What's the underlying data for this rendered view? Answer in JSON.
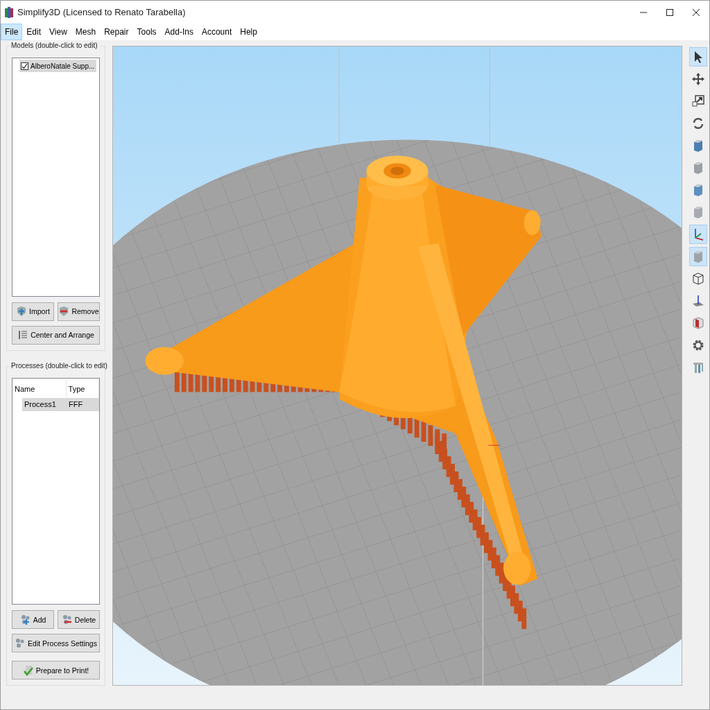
{
  "window": {
    "title": "Simplify3D (Licensed to Renato Tarabella)"
  },
  "menu": [
    {
      "label": "File",
      "selected": true
    },
    {
      "label": "Edit",
      "selected": false
    },
    {
      "label": "View",
      "selected": false
    },
    {
      "label": "Mesh",
      "selected": false
    },
    {
      "label": "Repair",
      "selected": false
    },
    {
      "label": "Tools",
      "selected": false
    },
    {
      "label": "Add-Ins",
      "selected": false
    },
    {
      "label": "Account",
      "selected": false
    },
    {
      "label": "Help",
      "selected": false
    }
  ],
  "models": {
    "title": "Models (double-click to edit)",
    "items": [
      {
        "label": "AlberoNatale Supp...",
        "checked": true,
        "selected": true
      }
    ],
    "buttons": [
      {
        "kind": "import",
        "label": "Import"
      },
      {
        "kind": "remove",
        "label": "Remove"
      },
      {
        "kind": "arrange",
        "label": "Center and Arrange"
      }
    ]
  },
  "processes": {
    "title": "Processes (double-click to edit)",
    "columns": [
      "Name",
      "Type"
    ],
    "rows": [
      {
        "cells": [
          "Process1",
          "FFF"
        ],
        "selected": true
      }
    ],
    "buttons": [
      {
        "kind": "add",
        "label": "Add"
      },
      {
        "kind": "delete",
        "label": "Delete"
      },
      {
        "kind": "settings",
        "label": "Edit Process Settings"
      },
      {
        "kind": "prepare",
        "label": "Prepare to Print!"
      }
    ]
  },
  "toolbar": [
    {
      "kind": "pointer",
      "selected": true
    },
    {
      "kind": "move",
      "selected": false
    },
    {
      "kind": "scale",
      "selected": false
    },
    {
      "kind": "rotate",
      "selected": false
    },
    {
      "kind": "cube",
      "selected": false
    },
    {
      "kind": "cube",
      "selected": false
    },
    {
      "kind": "cube",
      "selected": false
    },
    {
      "kind": "cube",
      "selected": false
    },
    {
      "kind": "axes",
      "selected": true
    },
    {
      "kind": "solid",
      "selected": true
    },
    {
      "kind": "wireframe",
      "selected": false
    },
    {
      "kind": "plane",
      "selected": false
    },
    {
      "kind": "section",
      "selected": false
    },
    {
      "kind": "gear",
      "selected": false
    },
    {
      "kind": "columns",
      "selected": false
    }
  ]
}
